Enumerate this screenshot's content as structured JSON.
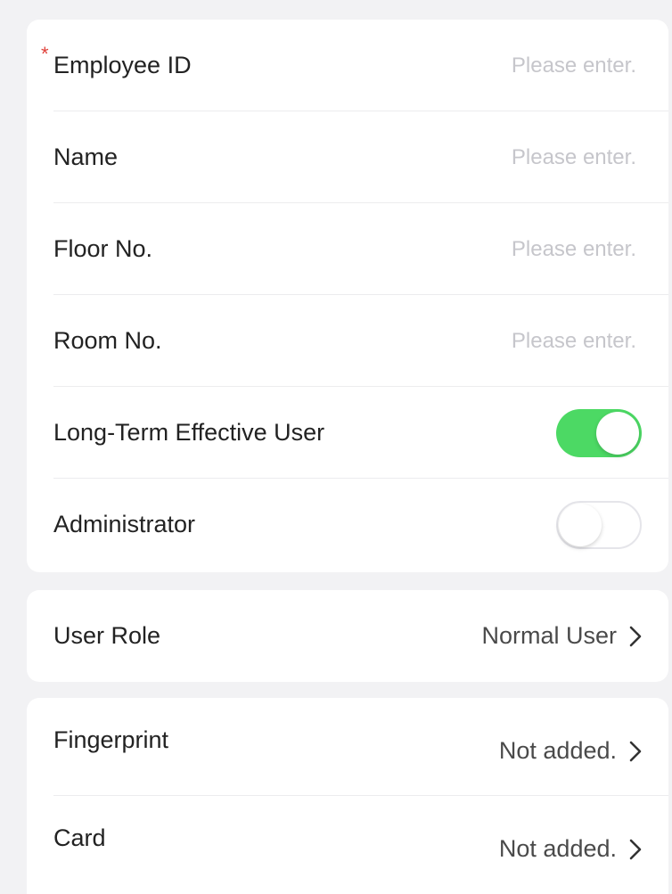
{
  "basic_info": {
    "employee_id": {
      "label": "Employee ID",
      "required_mark": "*",
      "placeholder": "Please enter.",
      "value": ""
    },
    "name": {
      "label": "Name",
      "placeholder": "Please enter.",
      "value": ""
    },
    "floor_no": {
      "label": "Floor No.",
      "placeholder": "Please enter.",
      "value": ""
    },
    "room_no": {
      "label": "Room No.",
      "placeholder": "Please enter.",
      "value": ""
    },
    "long_term": {
      "label": "Long-Term Effective User",
      "enabled": true
    },
    "administrator": {
      "label": "Administrator",
      "enabled": false
    }
  },
  "role": {
    "label": "User Role",
    "value": "Normal User"
  },
  "credentials": {
    "fingerprint": {
      "label": "Fingerprint",
      "value": "Not added."
    },
    "card": {
      "label": "Card",
      "value": "Not added."
    }
  },
  "colors": {
    "toggle_on": "#4cd964",
    "required": "#e0413a",
    "placeholder": "#c6c6cb",
    "background": "#f2f2f4"
  },
  "icons": {
    "chevron": "chevron-right-icon"
  }
}
